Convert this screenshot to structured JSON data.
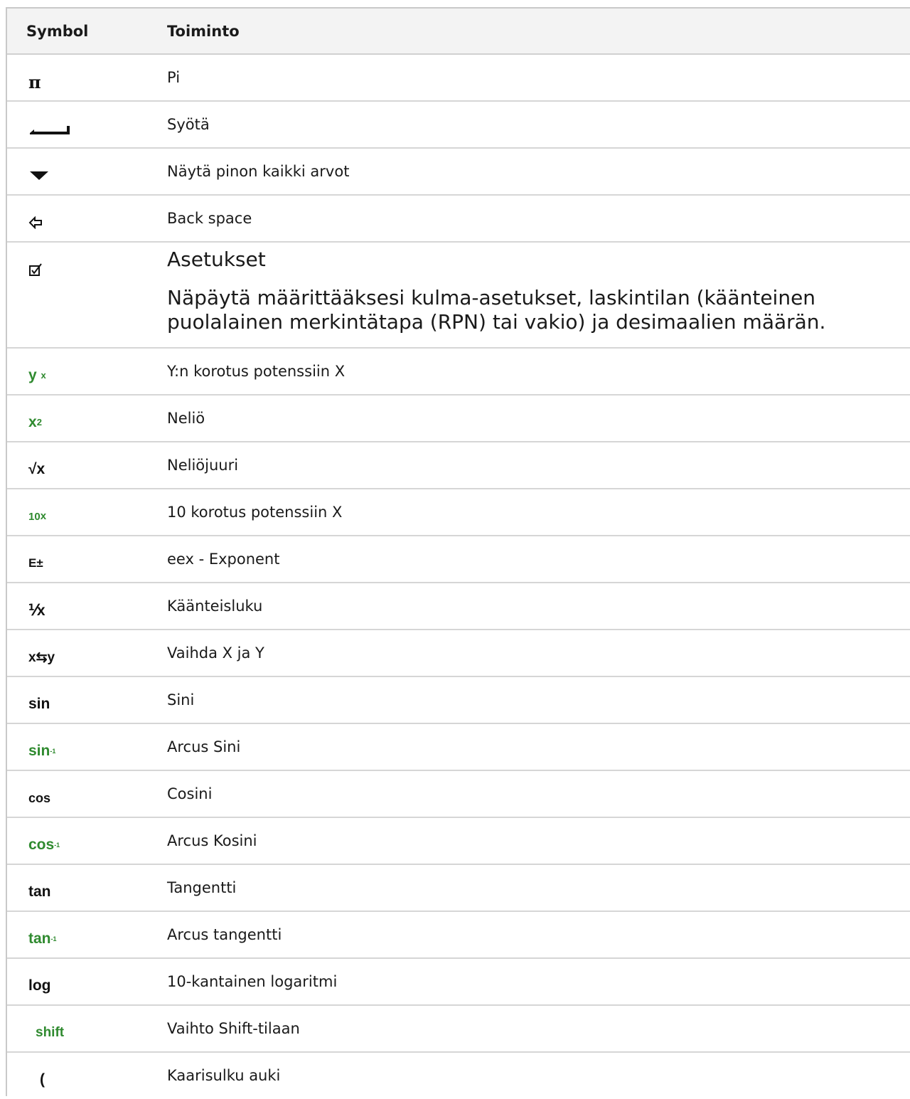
{
  "header": {
    "symbol": "Symbol",
    "function": "Toiminto"
  },
  "rows": [
    {
      "id": "pi",
      "symbol": "π",
      "function": "Pi"
    },
    {
      "id": "enter",
      "symbol": "",
      "function": "Syötä"
    },
    {
      "id": "stack",
      "symbol": "",
      "function": "Näytä pinon kaikki arvot"
    },
    {
      "id": "backspace",
      "symbol": "",
      "function": "Back space"
    },
    {
      "id": "settings",
      "symbol": "",
      "function": "Asetukset",
      "description": "Näpäytä määrittääksesi kulma-asetukset, laskintilan (käänteinen puolalainen merkintätapa (RPN) tai vakio) ja desimaalien määrän."
    },
    {
      "id": "power",
      "symbol_base": "y",
      "symbol_sup": "x",
      "function": "Y:n korotus potenssiin X"
    },
    {
      "id": "square",
      "symbol_base": "x",
      "symbol_sup": "2",
      "function": "Neliö"
    },
    {
      "id": "sqrt",
      "symbol": "√x",
      "function": "Neliöjuuri"
    },
    {
      "id": "tenpow",
      "symbol_base": "10",
      "symbol_sup": "x",
      "function": "10 korotus potenssiin X"
    },
    {
      "id": "eex",
      "symbol": "E±",
      "function": "eex - Exponent"
    },
    {
      "id": "reciprocal",
      "symbol": "⅟x",
      "function": "Käänteisluku"
    },
    {
      "id": "swap",
      "symbol": "x⇆y",
      "function": "Vaihda X ja Y"
    },
    {
      "id": "sin",
      "symbol": "sin",
      "function": "Sini"
    },
    {
      "id": "asin",
      "symbol_base": "sin",
      "symbol_sup": "-1",
      "function": "Arcus Sini"
    },
    {
      "id": "cos",
      "symbol": "cos",
      "function": "Cosini"
    },
    {
      "id": "acos",
      "symbol_base": "cos",
      "symbol_sup": "-1",
      "function": "Arcus Kosini"
    },
    {
      "id": "tan",
      "symbol": "tan",
      "function": "Tangentti"
    },
    {
      "id": "atan",
      "symbol_base": "tan",
      "symbol_sup": "-1",
      "function": "Arcus tangentti"
    },
    {
      "id": "log",
      "symbol": "log",
      "function": "10-kantainen logaritmi"
    },
    {
      "id": "shift",
      "symbol": "shift",
      "function": "Vaihto Shift-tilaan"
    },
    {
      "id": "paren",
      "symbol": "(",
      "function": "Kaarisulku auki"
    }
  ],
  "colors": {
    "green": "#2f8a2f",
    "header_bg": "#f3f3f3",
    "border": "#d6d6d6"
  }
}
